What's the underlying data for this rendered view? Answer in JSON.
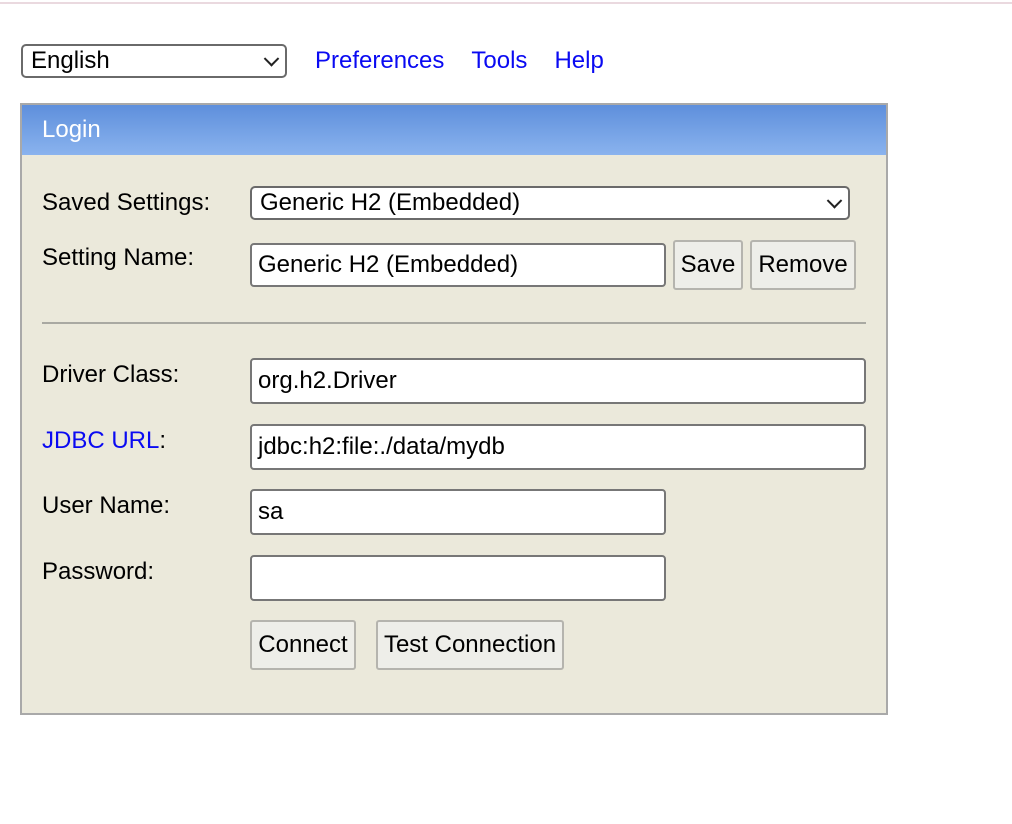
{
  "topbar": {
    "language": "English",
    "links": [
      "Preferences",
      "Tools",
      "Help"
    ]
  },
  "login": {
    "title": "Login",
    "saved_settings_label": "Saved Settings:",
    "saved_settings_value": "Generic H2 (Embedded)",
    "setting_name_label": "Setting Name:",
    "setting_name_value": "Generic H2 (Embedded)",
    "save_label": "Save",
    "remove_label": "Remove",
    "driver_class_label": "Driver Class:",
    "driver_class_value": "org.h2.Driver",
    "jdbc_url_link": "JDBC URL",
    "jdbc_url_colon": ":",
    "jdbc_url_value": "jdbc:h2:file:./data/mydb",
    "user_name_label": "User Name:",
    "user_name_value": "sa",
    "password_label": "Password:",
    "password_value": "",
    "connect_label": "Connect",
    "test_connection_label": "Test Connection"
  },
  "colors": {
    "link": "#0a0af2",
    "panel_bg": "#ebe9db",
    "header_gradient_top": "#5e8fdc",
    "header_gradient_bottom": "#8ab3ee"
  },
  "icons": {
    "dropdown": "chevron-down-icon"
  }
}
